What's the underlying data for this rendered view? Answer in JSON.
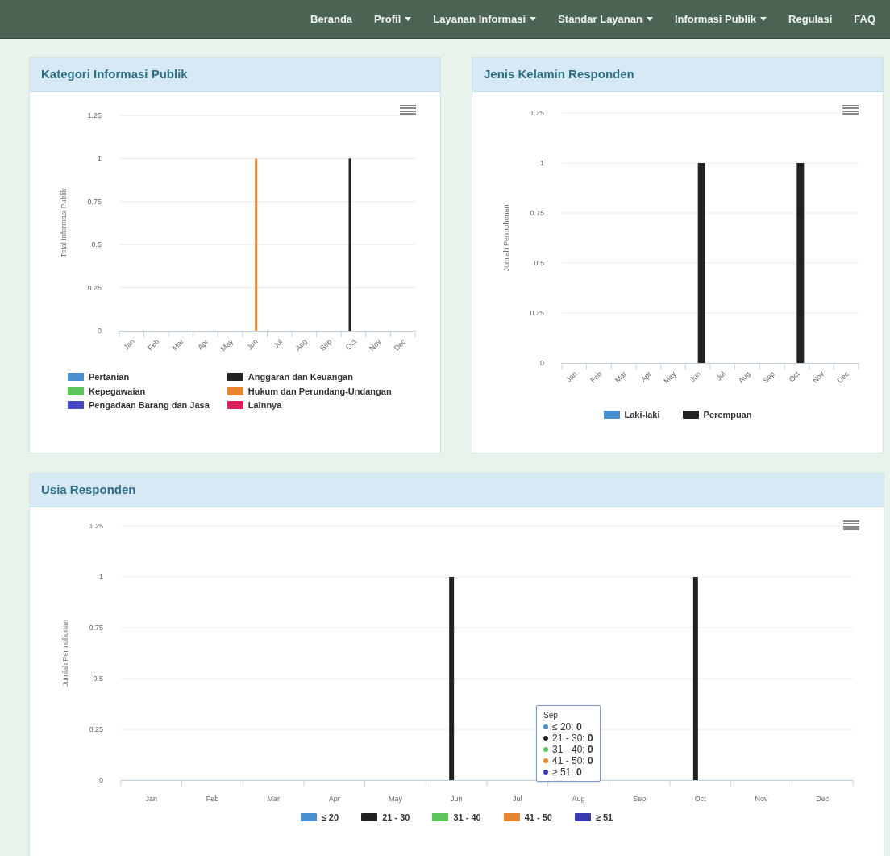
{
  "nav": {
    "items": [
      {
        "label": "Beranda",
        "dropdown": false
      },
      {
        "label": "Profil",
        "dropdown": true
      },
      {
        "label": "Layanan Informasi",
        "dropdown": true
      },
      {
        "label": "Standar Layanan",
        "dropdown": true
      },
      {
        "label": "Informasi Publik",
        "dropdown": true
      },
      {
        "label": "Regulasi",
        "dropdown": false
      },
      {
        "label": "FAQ",
        "dropdown": false
      }
    ]
  },
  "panels": [
    {
      "title": "Kategori Informasi Publik",
      "chart_data": {
        "type": "bar",
        "grid": true,
        "ylabel": "Total Informasi Publik",
        "categories": [
          "Jan",
          "Feb",
          "Mar",
          "Apr",
          "May",
          "Jun",
          "Jul",
          "Aug",
          "Sep",
          "Oct",
          "Nov",
          "Dec"
        ],
        "ylim": [
          0,
          1.25
        ],
        "yticks": [
          0,
          0.25,
          0.5,
          0.75,
          1,
          1.25
        ],
        "series": [
          {
            "name": "Pertanian",
            "color": "#4a8fd0",
            "values": [
              0,
              0,
              0,
              0,
              0,
              0,
              0,
              0,
              0,
              0,
              0,
              0
            ]
          },
          {
            "name": "Anggaran dan Keuangan",
            "color": "#222222",
            "values": [
              0,
              0,
              0,
              0,
              0,
              0,
              0,
              0,
              0,
              1,
              0,
              0
            ]
          },
          {
            "name": "Kepegawaian",
            "color": "#5cc65c",
            "values": [
              0,
              0,
              0,
              0,
              0,
              0,
              0,
              0,
              0,
              0,
              0,
              0
            ]
          },
          {
            "name": "Hukum dan Perundang-Undangan",
            "color": "#e8842f",
            "values": [
              0,
              0,
              0,
              0,
              0,
              1,
              0,
              0,
              0,
              0,
              0,
              0
            ]
          },
          {
            "name": "Pengadaan Barang dan Jasa",
            "color": "#4848c8",
            "values": [
              0,
              0,
              0,
              0,
              0,
              0,
              0,
              0,
              0,
              0,
              0,
              0
            ]
          },
          {
            "name": "Lainnya",
            "color": "#d8245a",
            "values": [
              0,
              0,
              0,
              0,
              0,
              0,
              0,
              0,
              0,
              0,
              0,
              0
            ]
          }
        ]
      }
    },
    {
      "title": "Jenis Kelamin Responden",
      "chart_data": {
        "type": "bar",
        "grid": true,
        "ylabel": "Jumlah Permohonan",
        "categories": [
          "Jan",
          "Feb",
          "Mar",
          "Apr",
          "May",
          "Jun",
          "Jul",
          "Aug",
          "Sep",
          "Oct",
          "Nov",
          "Dec"
        ],
        "ylim": [
          0,
          1.25
        ],
        "yticks": [
          0,
          0.25,
          0.5,
          0.75,
          1,
          1.25
        ],
        "series": [
          {
            "name": "Laki-laki",
            "color": "#4a8fd0",
            "values": [
              0,
              0,
              0,
              0,
              0,
              0,
              0,
              0,
              0,
              0,
              0,
              0
            ]
          },
          {
            "name": "Perempuan",
            "color": "#222222",
            "values": [
              0,
              0,
              0,
              0,
              0,
              1,
              0,
              0,
              0,
              1,
              0,
              0
            ]
          }
        ]
      }
    },
    {
      "title": "Usia Responden",
      "chart_data": {
        "type": "bar",
        "grid": true,
        "ylabel": "Jumlah Permohonan",
        "categories": [
          "Jan",
          "Feb",
          "Mar",
          "Apr",
          "May",
          "Jun",
          "Jul",
          "Aug",
          "Sep",
          "Oct",
          "Nov",
          "Dec"
        ],
        "ylim": [
          0,
          1.25
        ],
        "yticks": [
          0,
          0.25,
          0.5,
          0.75,
          1,
          1.25
        ],
        "series": [
          {
            "name": "≤ 20",
            "color": "#4a8fd0",
            "values": [
              0,
              0,
              0,
              0,
              0,
              0,
              0,
              0,
              0,
              0,
              0,
              0
            ]
          },
          {
            "name": "21 - 30",
            "color": "#222222",
            "values": [
              0,
              0,
              0,
              0,
              0,
              1,
              0,
              0,
              0,
              1,
              0,
              0
            ]
          },
          {
            "name": "31 - 40",
            "color": "#5cc65c",
            "values": [
              0,
              0,
              0,
              0,
              0,
              0,
              0,
              0,
              0,
              0,
              0,
              0
            ]
          },
          {
            "name": "41 - 50",
            "color": "#e8842f",
            "values": [
              0,
              0,
              0,
              0,
              0,
              0,
              0,
              0,
              0,
              0,
              0,
              0
            ]
          },
          {
            "name": "≥ 51",
            "color": "#3a3ab0",
            "values": [
              0,
              0,
              0,
              0,
              0,
              0,
              0,
              0,
              0,
              0,
              0,
              0
            ]
          }
        ]
      },
      "tooltip": {
        "title": "Sep",
        "rows": [
          "≤ 20: **0**",
          "21 - 30: **0**",
          "31 - 40: **0**",
          "41 - 50: **0**",
          "≥ 51: **0**"
        ]
      }
    }
  ]
}
